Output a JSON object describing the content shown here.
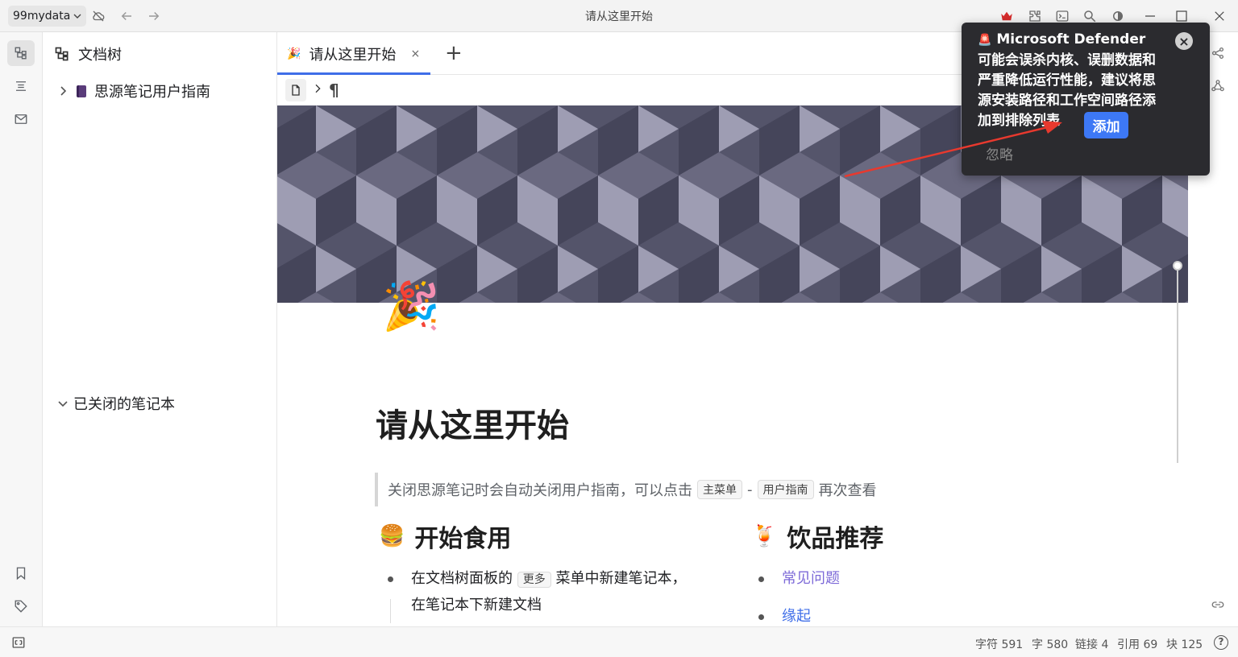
{
  "titlebar": {
    "workspace": "99mydata",
    "title": "请从这里开始"
  },
  "filetree": {
    "header": "文档树",
    "notebook": "思源笔记用户指南",
    "closed_section": "已关闭的笔记本"
  },
  "tabs": [
    {
      "icon": "🎉",
      "label": "请从这里开始",
      "close": "×"
    }
  ],
  "tab_add": "+",
  "breadcrumb": {
    "para": "¶"
  },
  "document": {
    "icon": "🎉",
    "title": "请从这里开始",
    "quote": {
      "text": "关闭思源笔记时会自动关闭用户指南，可以点击",
      "kbd1": "主菜单",
      "sep": "-",
      "kbd2": "用户指南",
      "text_end": "再次查看"
    },
    "section1": {
      "emoji": "🍔",
      "heading": "开始食用",
      "item_pre": "在文档树面板的",
      "item_kbd": "更多",
      "item_post": "菜单中新建笔记本，",
      "item_line2": "在笔记本下新建文档"
    },
    "section2": {
      "emoji": "🍹",
      "heading": "饮品推荐",
      "links": [
        "常见问题",
        "缘起"
      ]
    }
  },
  "notification": {
    "icon": "🚨",
    "message": "Microsoft Defender 可能会误杀内核、误删数据和严重降低运行性能，建议将思源安装路径和工作空间路径添加到排除列表",
    "add_button": "添加",
    "ignore": "忽略",
    "close": "×"
  },
  "statusbar": {
    "chars": "字符 591",
    "words": "字 580",
    "links": "链接 4",
    "refs": "引用 69",
    "blocks": "块 125",
    "help": "?"
  },
  "colors": {
    "accent": "#3f6ee8",
    "notification_bg": "#2b2b2f",
    "add_button": "#3d78f5",
    "annotation_arrow": "#e8392e"
  }
}
